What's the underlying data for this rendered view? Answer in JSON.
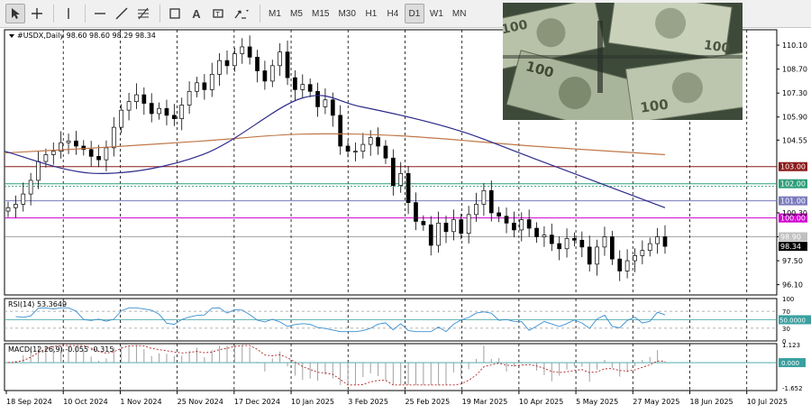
{
  "toolbar": {
    "periods": [
      "M1",
      "M5",
      "M15",
      "M30",
      "H1",
      "H4",
      "D1",
      "W1",
      "MN"
    ],
    "active_period": "D1",
    "tools": [
      "cursor-icon",
      "crosshair-icon",
      "vertical-line-icon",
      "horizontal-line-icon",
      "trendline-icon",
      "fibonacci-icon",
      "shapes-icon",
      "text-icon",
      "label-icon",
      "arrows-icon"
    ]
  },
  "colors": {
    "bull": "#000000",
    "bear": "#000000",
    "ma_slow": "#2b2b8a",
    "ma_fast": "#c0784a",
    "level_dark": "#8b1a1a",
    "level_green": "#2e9e7a",
    "level_blue": "#7b7bbd",
    "level_magenta": "#d000d0",
    "rsi": "#3a8fd0",
    "macd_signal": "#b02020",
    "macd_hist": "#a0a0a0"
  },
  "chart_data": [
    {
      "type": "candlestick",
      "title": "#USDX,Daily",
      "ohlc_label": "98.60 98.60 98.29 98.34",
      "ylim": [
        95.5,
        111.0
      ],
      "y_ticks": [
        "110.10",
        "108.70",
        "107.30",
        "105.90",
        "104.55",
        "103.00",
        "102.00",
        "101.00",
        "100.30",
        "98.90",
        "98.34",
        "97.50",
        "96.10"
      ],
      "x_ticks": [
        "18 Sep 2024",
        "10 Oct 2024",
        "1 Nov 2024",
        "25 Nov 2024",
        "17 Dec 2024",
        "10 Jan 2025",
        "3 Feb 2025",
        "25 Feb 2025",
        "19 Mar 2025",
        "10 Apr 2025",
        "5 May 2025",
        "27 May 2025",
        "18 Jun 2025",
        "10 Jul 2025"
      ],
      "close_path": [
        100.6,
        100.8,
        101.4,
        102.2,
        103.3,
        103.7,
        103.9,
        104.4,
        104.5,
        104.2,
        104.0,
        103.6,
        103.4,
        104.1,
        105.3,
        106.3,
        106.8,
        107.2,
        106.7,
        106.1,
        106.4,
        106.0,
        105.8,
        106.6,
        107.4,
        107.9,
        107.5,
        108.4,
        109.2,
        108.9,
        109.6,
        110.0,
        109.4,
        108.6,
        108.0,
        108.9,
        109.7,
        108.2,
        107.5,
        107.8,
        107.4,
        106.5,
        106.9,
        106.0,
        104.2,
        103.9,
        103.9,
        104.3,
        104.7,
        104.2,
        103.5,
        101.9,
        102.6,
        100.9,
        99.8,
        99.6,
        98.4,
        99.7,
        99.2,
        99.9,
        99.1,
        100.2,
        100.8,
        101.6,
        100.3,
        100.1,
        99.7,
        99.3,
        99.9,
        99.4,
        98.9,
        99.0,
        98.5,
        98.2,
        98.8,
        98.7,
        98.3,
        97.3,
        98.3,
        98.9,
        97.6,
        96.9,
        97.5,
        97.8,
        98.1,
        98.5,
        98.9,
        98.34
      ],
      "ma_slow_points": [
        [
          0,
          103.9
        ],
        [
          14,
          102.6
        ],
        [
          30,
          103.7
        ],
        [
          45,
          107.0
        ],
        [
          54,
          106.5
        ],
        [
          68,
          105.2
        ],
        [
          80,
          103.5
        ],
        [
          100,
          100.6
        ]
      ],
      "ma_fast_points": [
        [
          0,
          103.8
        ],
        [
          14,
          104.1
        ],
        [
          30,
          104.5
        ],
        [
          45,
          104.9
        ],
        [
          60,
          104.8
        ],
        [
          80,
          104.2
        ],
        [
          100,
          103.7
        ]
      ],
      "levels": [
        {
          "label": "103.00",
          "value": 103.0,
          "color": "level_dark"
        },
        {
          "label": "102.00",
          "value": 102.0,
          "color": "level_green"
        },
        {
          "label": "101.00",
          "value": 101.0,
          "color": "level_blue"
        },
        {
          "label": "100.00",
          "value": 100.0,
          "color": "level_magenta"
        }
      ],
      "current_price": "98.34",
      "prev_label": "98.90"
    },
    {
      "type": "line",
      "title": "RSI(14) 53.3649",
      "ylim": [
        0,
        100
      ],
      "y_ticks": [
        "100",
        "70",
        "30",
        "0"
      ],
      "level_label": "50.0000"
    },
    {
      "type": "bar",
      "title": "MACD(12,26,9) -0.055 -0.315",
      "y_ticks": [
        "1.123",
        "0.000",
        "-1.652"
      ]
    }
  ]
}
